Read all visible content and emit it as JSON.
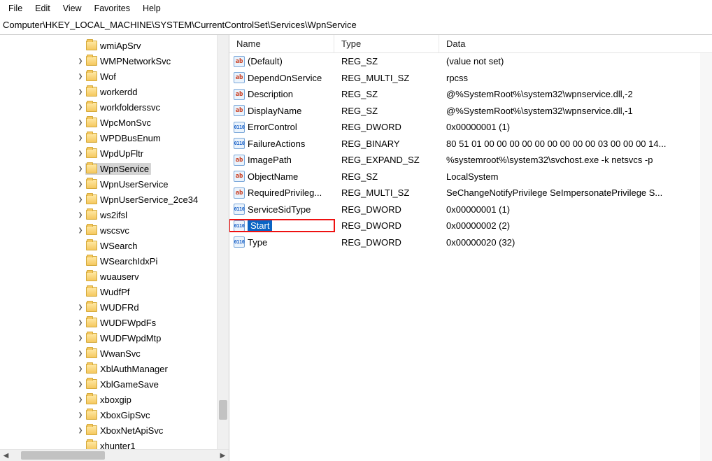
{
  "menu": {
    "file": "File",
    "edit": "Edit",
    "view": "View",
    "favorites": "Favorites",
    "help": "Help"
  },
  "address": "Computer\\HKEY_LOCAL_MACHINE\\SYSTEM\\CurrentControlSet\\Services\\WpnService",
  "tree": {
    "indent_base": 108,
    "items": [
      {
        "label": "wmiApSrv",
        "expander": ""
      },
      {
        "label": "WMPNetworkSvc",
        "expander": ">"
      },
      {
        "label": "Wof",
        "expander": ">"
      },
      {
        "label": "workerdd",
        "expander": ">"
      },
      {
        "label": "workfolderssvc",
        "expander": ">"
      },
      {
        "label": "WpcMonSvc",
        "expander": ">"
      },
      {
        "label": "WPDBusEnum",
        "expander": ">"
      },
      {
        "label": "WpdUpFltr",
        "expander": ">"
      },
      {
        "label": "WpnService",
        "expander": ">",
        "selected": true
      },
      {
        "label": "WpnUserService",
        "expander": ">"
      },
      {
        "label": "WpnUserService_2ce34",
        "expander": ">"
      },
      {
        "label": "ws2ifsl",
        "expander": ">"
      },
      {
        "label": "wscsvc",
        "expander": ">"
      },
      {
        "label": "WSearch",
        "expander": ""
      },
      {
        "label": "WSearchIdxPi",
        "expander": ""
      },
      {
        "label": "wuauserv",
        "expander": ""
      },
      {
        "label": "WudfPf",
        "expander": ""
      },
      {
        "label": "WUDFRd",
        "expander": ">"
      },
      {
        "label": "WUDFWpdFs",
        "expander": ">"
      },
      {
        "label": "WUDFWpdMtp",
        "expander": ">"
      },
      {
        "label": "WwanSvc",
        "expander": ">"
      },
      {
        "label": "XblAuthManager",
        "expander": ">"
      },
      {
        "label": "XblGameSave",
        "expander": ">"
      },
      {
        "label": "xboxgip",
        "expander": ">"
      },
      {
        "label": "XboxGipSvc",
        "expander": ">"
      },
      {
        "label": "XboxNetApiSvc",
        "expander": ">"
      },
      {
        "label": "xhunter1",
        "expander": ""
      }
    ]
  },
  "columns": {
    "name": "Name",
    "type": "Type",
    "data": "Data"
  },
  "values": [
    {
      "icon": "str",
      "name": "(Default)",
      "type": "REG_SZ",
      "data": "(value not set)"
    },
    {
      "icon": "str",
      "name": "DependOnService",
      "type": "REG_MULTI_SZ",
      "data": "rpcss"
    },
    {
      "icon": "str",
      "name": "Description",
      "type": "REG_SZ",
      "data": "@%SystemRoot%\\system32\\wpnservice.dll,-2"
    },
    {
      "icon": "str",
      "name": "DisplayName",
      "type": "REG_SZ",
      "data": "@%SystemRoot%\\system32\\wpnservice.dll,-1"
    },
    {
      "icon": "bin",
      "name": "ErrorControl",
      "type": "REG_DWORD",
      "data": "0x00000001 (1)"
    },
    {
      "icon": "bin",
      "name": "FailureActions",
      "type": "REG_BINARY",
      "data": "80 51 01 00 00 00 00 00 00 00 00 00 03 00 00 00 14..."
    },
    {
      "icon": "str",
      "name": "ImagePath",
      "type": "REG_EXPAND_SZ",
      "data": "%systemroot%\\system32\\svchost.exe -k netsvcs -p"
    },
    {
      "icon": "str",
      "name": "ObjectName",
      "type": "REG_SZ",
      "data": "LocalSystem"
    },
    {
      "icon": "str",
      "name": "RequiredPrivileg...",
      "type": "REG_MULTI_SZ",
      "data": "SeChangeNotifyPrivilege SeImpersonatePrivilege S..."
    },
    {
      "icon": "bin",
      "name": "ServiceSidType",
      "type": "REG_DWORD",
      "data": "0x00000001 (1)"
    },
    {
      "icon": "bin",
      "name": "Start",
      "type": "REG_DWORD",
      "data": "0x00000002 (2)",
      "selected": true,
      "highlight": true
    },
    {
      "icon": "bin",
      "name": "Type",
      "type": "REG_DWORD",
      "data": "0x00000020 (32)"
    }
  ],
  "icon_text": {
    "str": "ab",
    "bin": "011\n110"
  }
}
